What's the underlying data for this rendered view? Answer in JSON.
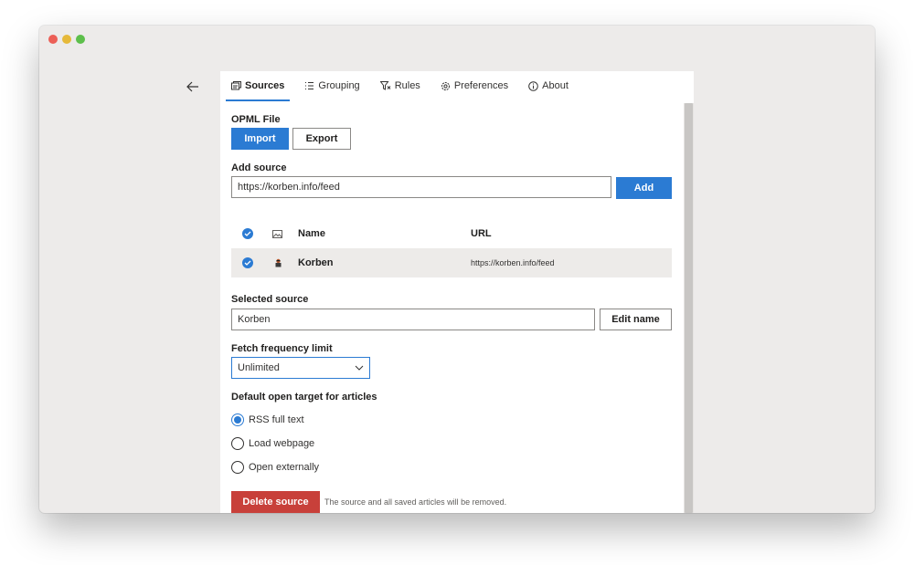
{
  "tabs": [
    {
      "label": "Sources",
      "icon": "sources-icon"
    },
    {
      "label": "Grouping",
      "icon": "grouping-icon"
    },
    {
      "label": "Rules",
      "icon": "filter-icon"
    },
    {
      "label": "Preferences",
      "icon": "gear-icon"
    },
    {
      "label": "About",
      "icon": "info-icon"
    }
  ],
  "opml": {
    "label": "OPML File",
    "import_label": "Import",
    "export_label": "Export"
  },
  "add_source": {
    "label": "Add source",
    "value": "https://korben.info/feed",
    "button_label": "Add"
  },
  "table": {
    "headers": {
      "name": "Name",
      "url": "URL"
    },
    "rows": [
      {
        "name": "Korben",
        "url": "https://korben.info/feed",
        "selected": true
      }
    ]
  },
  "selected_source": {
    "label": "Selected source",
    "value": "Korben",
    "button_label": "Edit name"
  },
  "fetch": {
    "label": "Fetch frequency limit",
    "selected": "Unlimited"
  },
  "open_target": {
    "label": "Default open target for articles",
    "options": [
      "RSS full text",
      "Load webpage",
      "Open externally"
    ],
    "selected_index": 0
  },
  "delete": {
    "button_label": "Delete source",
    "hint": "The source and all saved articles will be removed."
  },
  "colors": {
    "accent": "#2b7bd3",
    "danger": "#c8403a",
    "row_highlight": "#edebe9"
  }
}
